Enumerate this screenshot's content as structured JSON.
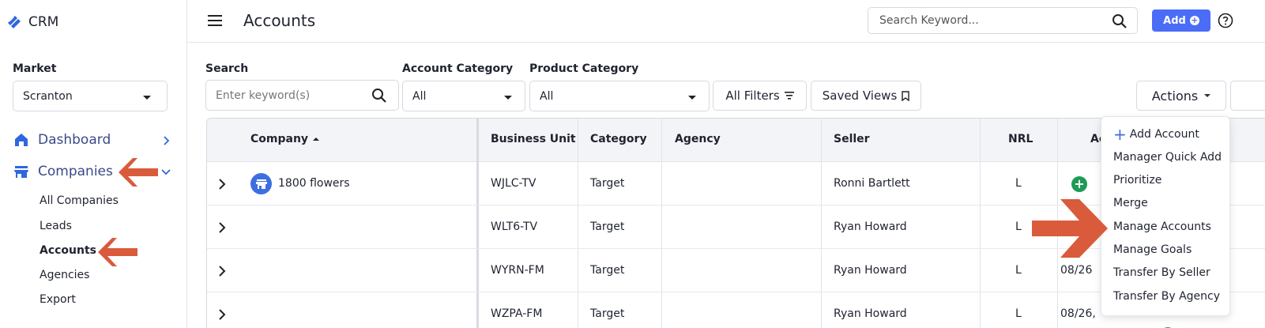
{
  "app": {
    "name": "CRM"
  },
  "header": {
    "title": "Accounts",
    "search_placeholder": "Search Keyword...",
    "add_label": "Add"
  },
  "sidebar": {
    "market_label": "Market",
    "market_value": "Scranton",
    "nav": [
      {
        "label": "Dashboard",
        "icon": "home-icon"
      },
      {
        "label": "Companies",
        "icon": "store-icon"
      }
    ],
    "sub_items": [
      "All Companies",
      "Leads",
      "Accounts",
      "Agencies",
      "Export"
    ]
  },
  "filters": {
    "search_label": "Search",
    "search_placeholder": "Enter keyword(s)",
    "account_category_label": "Account Category",
    "account_category_value": "All",
    "product_category_label": "Product Category",
    "product_category_value": "All",
    "all_filters_label": "All Filters",
    "saved_views_label": "Saved Views",
    "actions_label": "Actions"
  },
  "table": {
    "columns": [
      "Company",
      "Business Unit",
      "Category",
      "Agency",
      "Seller",
      "NRL",
      "Ac"
    ],
    "rows": [
      {
        "company": "1800 flowers",
        "business_unit": "WJLC-TV",
        "category": "Target",
        "agency": "",
        "seller": "Ronni Bartlett",
        "nrl": "L",
        "ac": ""
      },
      {
        "company": "",
        "business_unit": "WLT6-TV",
        "category": "Target",
        "agency": "",
        "seller": "Ryan Howard",
        "nrl": "L",
        "ac": ""
      },
      {
        "company": "",
        "business_unit": "WYRN-FM",
        "category": "Target",
        "agency": "",
        "seller": "Ryan Howard",
        "nrl": "L",
        "ac": "08/26"
      },
      {
        "company": "",
        "business_unit": "WZPA-FM",
        "category": "Target",
        "agency": "",
        "seller": "Ryan Howard",
        "nrl": "L",
        "ac": "08/26,"
      }
    ]
  },
  "actions_menu": {
    "items": [
      "Add Account",
      "Manager Quick Add",
      "Prioritize",
      "Merge",
      "Manage Accounts",
      "Manage Goals",
      "Transfer By Seller",
      "Transfer By Agency"
    ]
  },
  "colors": {
    "accent": "#4a6cf7",
    "nav_text": "#3a4a8a",
    "annotation_arrow": "#d95b3c",
    "green": "#1f9a56"
  }
}
